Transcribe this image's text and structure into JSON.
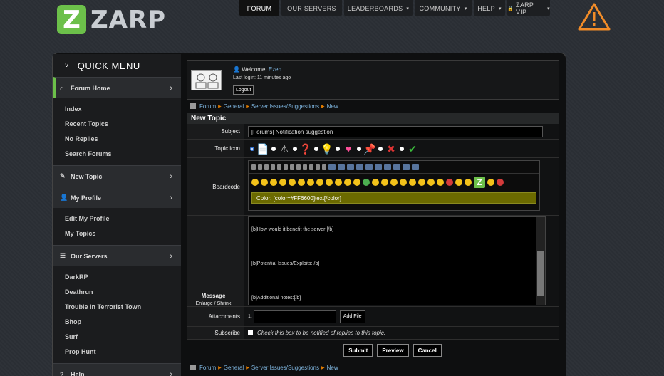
{
  "logo": {
    "letter": "Z",
    "text": "ZARP",
    "color": "#6cc04a"
  },
  "topnav": [
    {
      "label": "FORUM",
      "active": true,
      "caret": "",
      "w": 56
    },
    {
      "label": "OUR SERVERS",
      "caret": "",
      "w": 85
    },
    {
      "label": "LEADERBOARDS",
      "caret": "▾",
      "w": 96
    },
    {
      "label": "COMMUNITY",
      "caret": "▾",
      "w": 80
    },
    {
      "label": "HELP",
      "caret": "▾",
      "w": 44
    },
    {
      "label": "ZARP VIP",
      "icon": "lock",
      "caret": "▾",
      "w": 60
    }
  ],
  "sidebar": {
    "title": "QUICK MENU",
    "sections": [
      {
        "label": "Forum Home",
        "icon": "home-icon",
        "active": true,
        "items": [
          "Index",
          "Recent Topics",
          "No Replies",
          "Search Forums"
        ]
      },
      {
        "label": "New Topic",
        "icon": "pencil-icon",
        "items": []
      },
      {
        "label": "My Profile",
        "icon": "user-icon",
        "items": [
          "Edit My Profile",
          "My Topics"
        ]
      },
      {
        "label": "Our Servers",
        "icon": "list-icon",
        "items": [
          "DarkRP",
          "Deathrun",
          "Trouble in Terrorist Town",
          "Bhop",
          "Surf",
          "Prop Hunt"
        ]
      },
      {
        "label": "Help",
        "icon": "help-icon",
        "items": []
      }
    ]
  },
  "welcome": {
    "prefix": "Welcome, ",
    "username": "Ezeh",
    "last_login": "Last login: 11 minutes ago",
    "logout": "Logout"
  },
  "breadcrumb": [
    "Forum",
    "General",
    "Server Issues/Suggestions",
    "New"
  ],
  "form": {
    "header": "New Topic",
    "subject_label": "Subject",
    "subject_value": "[Forums] Notification suggestion",
    "topic_icon_label": "Topic icon",
    "boardcode_label": "Boardcode",
    "color_hint": "Color: [color=#FF6600]text[/color]",
    "message_label": "Message",
    "enlarge": "Enlarge",
    "shrink": "Shrink",
    "message_lines": [
      "[b]How would it benefit the server:[/b]",
      "[b]Potential Issues/Exploits:[/b]",
      "[b]Additional notes:[/b]"
    ],
    "attachments_label": "Attachments",
    "attach_index": "1.",
    "add_file": "Add File",
    "subscribe_label": "Subscribe",
    "subscribe_text": "Check this box to be notified of replies to this topic.",
    "buttons": {
      "submit": "Submit",
      "preview": "Preview",
      "cancel": "Cancel"
    }
  },
  "colors": {
    "accent": "#6cc04a",
    "link": "#7fb6e0",
    "crumb_sep": "#e07b00",
    "warning": "#f28c28"
  }
}
